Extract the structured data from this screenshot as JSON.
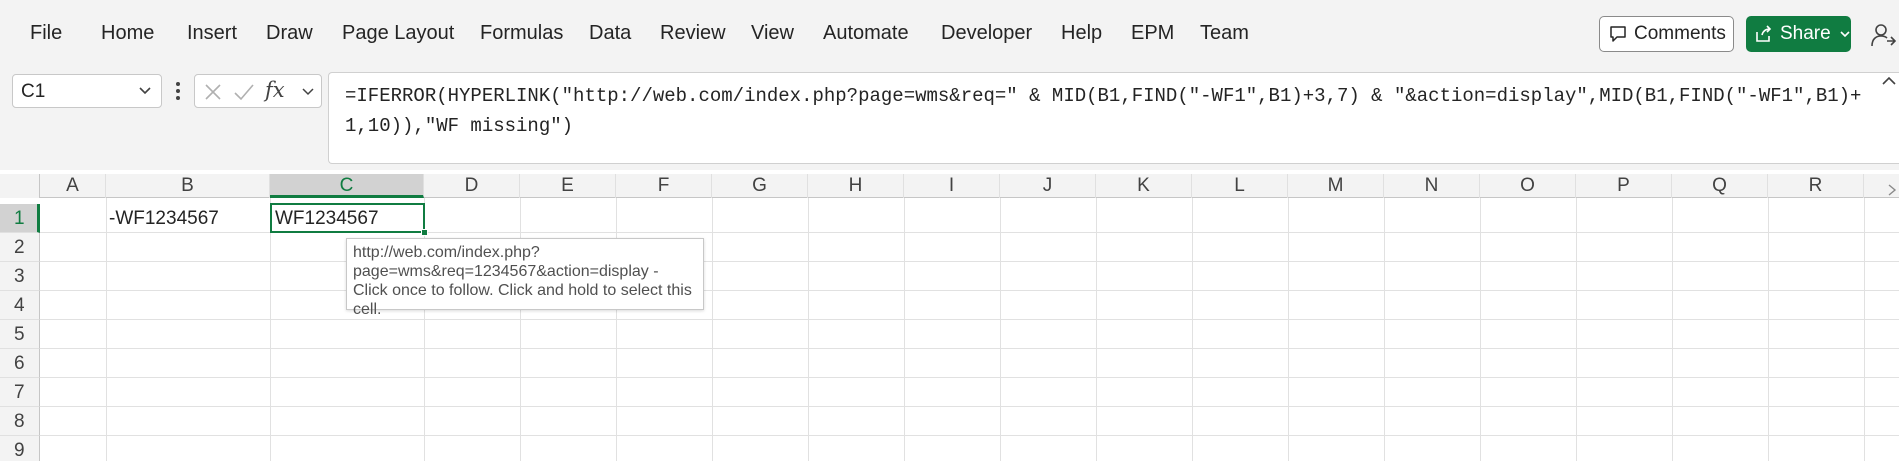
{
  "menu": {
    "items": [
      "File",
      "Home",
      "Insert",
      "Draw",
      "Page Layout",
      "Formulas",
      "Data",
      "Review",
      "View",
      "Automate",
      "Developer",
      "Help",
      "EPM",
      "Team"
    ]
  },
  "actions": {
    "comments_label": "Comments",
    "share_label": "Share"
  },
  "formula_bar": {
    "name_box": "C1",
    "fx_label": "fx",
    "formula": "=IFERROR(HYPERLINK(\"http://web.com/index.php?page=wms&req=\" & MID(B1,FIND(\"-WF1\",B1)+3,7) & \"&action=display\",MID(B1,FIND(\"-WF1\",B1)+1,10)),\"WF missing\")"
  },
  "grid": {
    "columns": [
      "A",
      "B",
      "C",
      "D",
      "E",
      "F",
      "G",
      "H",
      "I",
      "J",
      "K",
      "L",
      "M",
      "N",
      "O",
      "P",
      "Q",
      "R"
    ],
    "rows": [
      "1",
      "2",
      "3",
      "4",
      "5",
      "6",
      "7",
      "8",
      "9"
    ],
    "selected_column": "C",
    "selected_row": "1",
    "cells": {
      "B1": "-WF1234567",
      "C1": "WF1234567"
    }
  },
  "tooltip": {
    "text": "http://web.com/index.php?page=wms&req=1234567&action=display - Click once to follow. Click and hold to select this cell."
  },
  "colors": {
    "accent": "#107c41",
    "ribbon_bg": "#f3f3f3"
  }
}
